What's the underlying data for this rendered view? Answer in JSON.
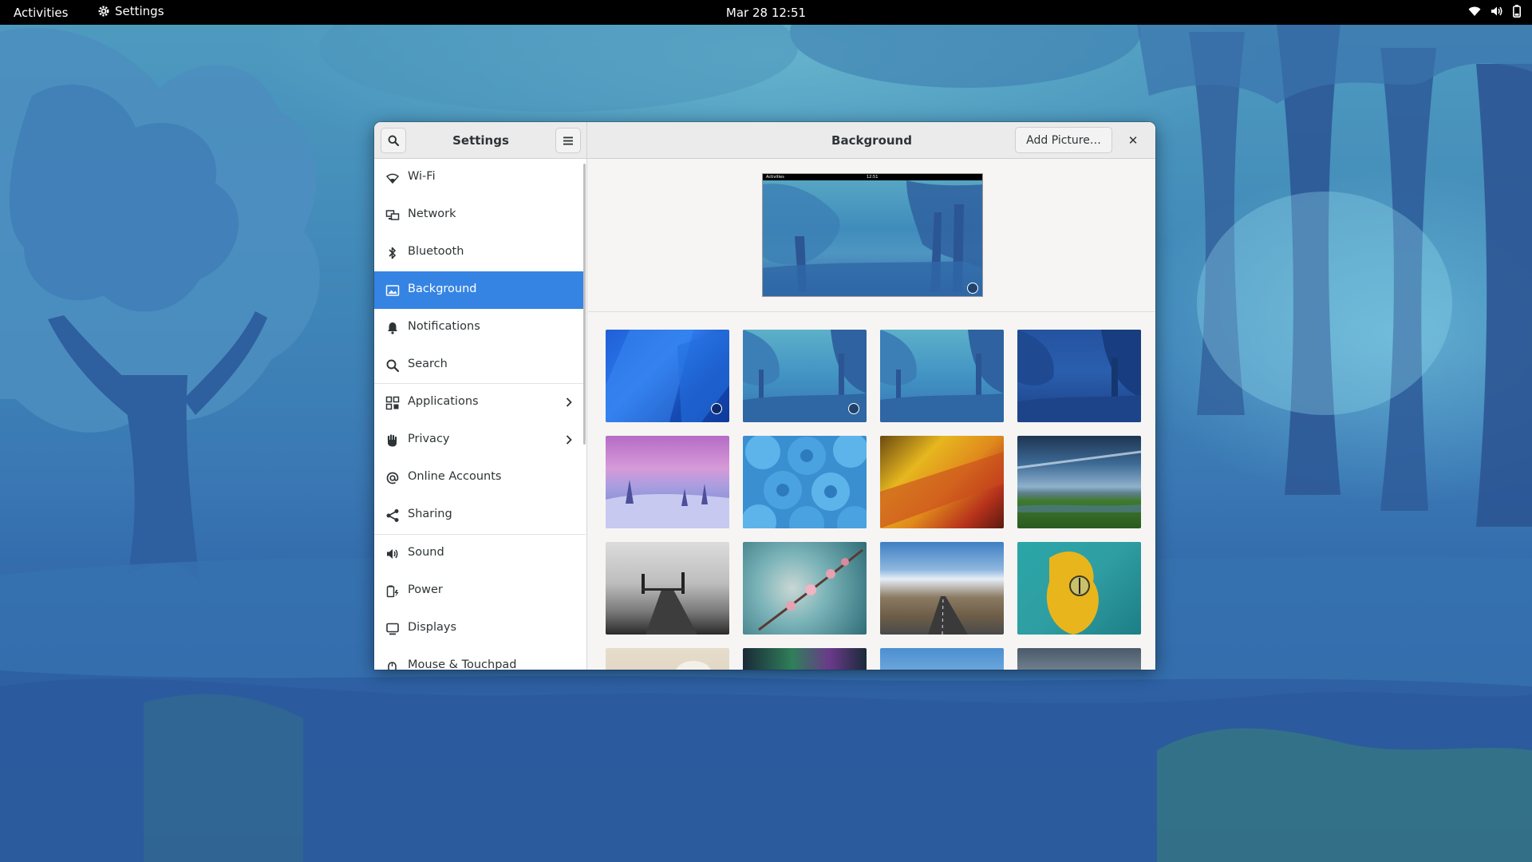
{
  "topbar": {
    "activities": "Activities",
    "app_name": "Settings",
    "clock": "Mar 28  12:51",
    "tray_icons": [
      "wifi-icon",
      "volume-icon",
      "battery-icon"
    ]
  },
  "window": {
    "sidebar_title": "Settings",
    "page_title": "Background",
    "add_picture_label": "Add Picture…",
    "close_glyph": "✕"
  },
  "sidebar": {
    "items": [
      {
        "label": "Wi-Fi",
        "icon": "wifi-icon"
      },
      {
        "label": "Network",
        "icon": "network-icon"
      },
      {
        "label": "Bluetooth",
        "icon": "bluetooth-icon"
      },
      {
        "label": "Background",
        "icon": "background-icon",
        "selected": true
      },
      {
        "label": "Notifications",
        "icon": "bell-icon"
      },
      {
        "label": "Search",
        "icon": "search-icon"
      },
      {
        "label": "Applications",
        "icon": "apps-grid-icon",
        "has_submenu": true
      },
      {
        "label": "Privacy",
        "icon": "hand-icon",
        "has_submenu": true
      },
      {
        "label": "Online Accounts",
        "icon": "at-icon"
      },
      {
        "label": "Sharing",
        "icon": "share-icon"
      },
      {
        "label": "Sound",
        "icon": "speaker-icon"
      },
      {
        "label": "Power",
        "icon": "power-icon"
      },
      {
        "label": "Displays",
        "icon": "display-icon"
      },
      {
        "label": "Mouse & Touchpad",
        "icon": "mouse-icon"
      }
    ]
  },
  "preview": {
    "mini_activities": "Activities",
    "mini_clock": "12:51"
  },
  "wallpapers": [
    {
      "name": "blue-geometric",
      "selected_light": true
    },
    {
      "name": "forest-light",
      "selected_dark": true
    },
    {
      "name": "forest-light-alt"
    },
    {
      "name": "forest-dark"
    },
    {
      "name": "snowy-sunset"
    },
    {
      "name": "blue-pieces"
    },
    {
      "name": "woven-fabric"
    },
    {
      "name": "green-field-sky"
    },
    {
      "name": "foggy-pier"
    },
    {
      "name": "cherry-blossom"
    },
    {
      "name": "mountain-road"
    },
    {
      "name": "yellow-frog"
    },
    {
      "name": "sand-stone"
    },
    {
      "name": "aurora"
    },
    {
      "name": "clouds-sky"
    },
    {
      "name": "misty-horizon"
    }
  ],
  "colors": {
    "accent": "#3584e4",
    "topbar": "#000000",
    "window_bg": "#f6f5f4"
  }
}
